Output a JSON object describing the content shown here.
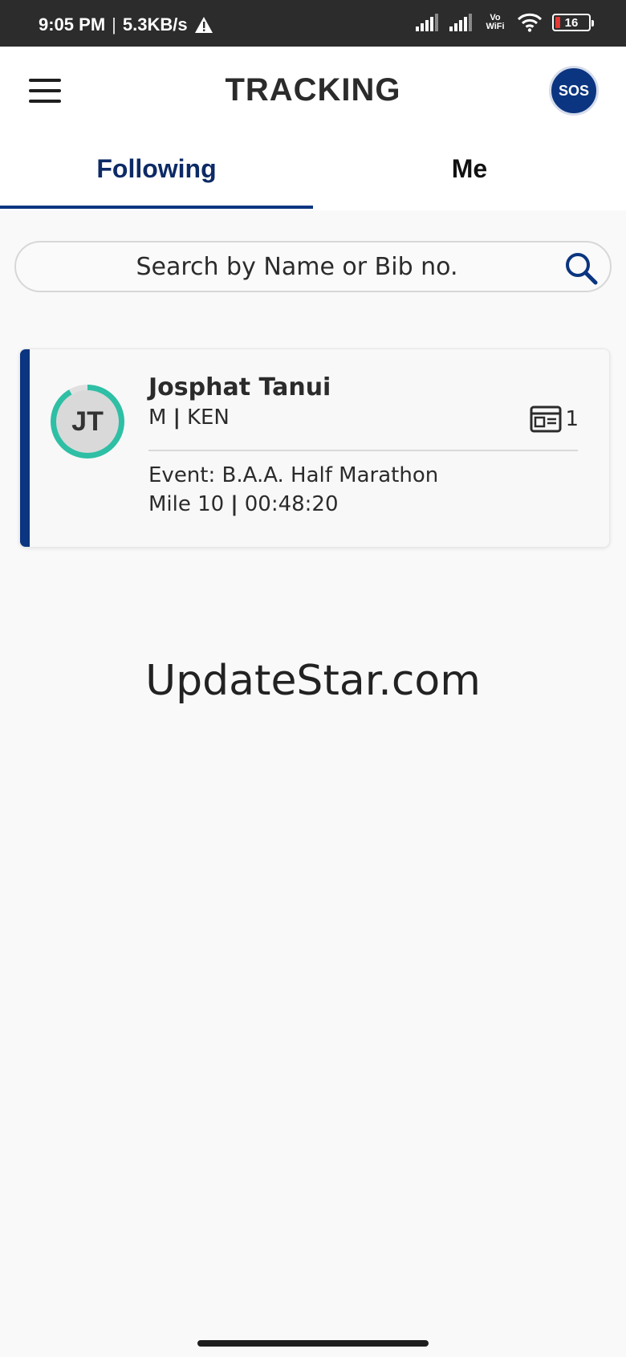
{
  "status_bar": {
    "time": "9:05 PM",
    "separator": "|",
    "speed": "5.3KB/s",
    "vowifi": "Vo WiFi",
    "battery": "16",
    "icons": [
      "warning-icon",
      "signal-icon",
      "signal-icon",
      "wifi-icon",
      "battery-icon"
    ]
  },
  "header": {
    "title": "TRACKING",
    "sos_label": "SOS",
    "accent_color": "#0b3580"
  },
  "tabs": [
    {
      "label": "Following",
      "active": true
    },
    {
      "label": "Me",
      "active": false
    }
  ],
  "search": {
    "placeholder": "Search by Name or Bib no.",
    "value": ""
  },
  "runner": {
    "initials": "JT",
    "name": "Josphat Tanui",
    "gender": "M",
    "country": "KEN",
    "bib_count": "1",
    "event": "Event: B.A.A. Half Marathon",
    "mile": "Mile 10",
    "time": "00:48:20",
    "ring_color": "#2ebfa5"
  },
  "watermark": "UpdateStar.com"
}
